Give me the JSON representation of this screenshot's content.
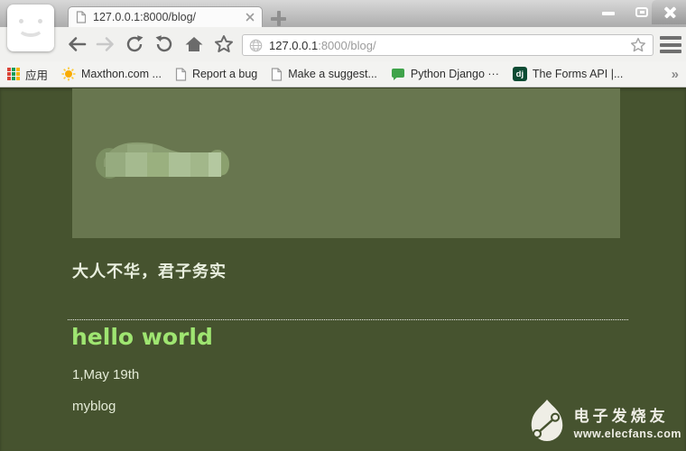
{
  "window": {
    "tab_title": "127.0.0.1:8000/blog/"
  },
  "address_bar": {
    "url_host": "127.0.0.1",
    "url_path": ":8000/blog/"
  },
  "bookmarks": {
    "overflow": "»",
    "items": [
      {
        "label": "应用",
        "icon": "apps-grid-icon"
      },
      {
        "label": "Maxthon.com ...",
        "icon": "sun-icon"
      },
      {
        "label": "Report a bug",
        "icon": "page-icon"
      },
      {
        "label": "Make a suggest...",
        "icon": "page-icon"
      },
      {
        "label": "Python Django ···",
        "icon": "chat-bubble-icon"
      },
      {
        "label": "The Forms API |...",
        "icon": "django-icon",
        "icon_text": "dj"
      }
    ]
  },
  "blog": {
    "motto": "大人不华，君子务实",
    "post_title": "hello world",
    "post_date": "1,May 19th",
    "post_body": "myblog"
  },
  "watermark": {
    "site_name": "电子发烧友",
    "site_url": "www.elecfans.com"
  },
  "colors": {
    "page_background": "#46532f",
    "header_box": "#68764f",
    "post_title_green": "#9fe571",
    "body_text": "#e4ebd7",
    "django_icon_green": "#0c4b33",
    "chat_bubble_green": "#3fa34a",
    "sun_orange": "#f9ab00"
  }
}
